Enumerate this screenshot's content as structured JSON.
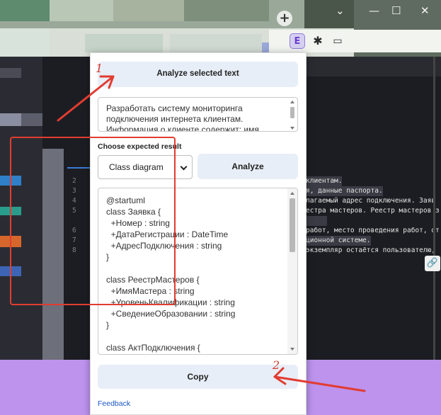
{
  "browser": {
    "new_tab_symbol": "+",
    "window_controls": {
      "minimize": "—",
      "maximize": "☐",
      "close": "✕",
      "collapse": "⌄"
    },
    "toolbar_icons": [
      "extension-active-icon",
      "puzzle-icon",
      "sidebar-icon"
    ],
    "ext_glyph": "E",
    "puzzle_glyph": "✱",
    "side_glyph": "▭"
  },
  "background_code": {
    "line_numbers": [
      "2",
      "3",
      "4",
      "5",
      "6",
      "7",
      "8"
    ],
    "lines": [
      "клиентам.",
      "я, данные паспорта.",
      "лагаемый адрес подключения. Заяв",
      "естра мастеров. Реестр мастеров з",
      "",
      "работ, место проведения работ, от",
      "ционной системе.",
      "экземпляр остаётся пользователю,"
    ],
    "link_glyph": "🔗"
  },
  "popup": {
    "analyze_selected_label": "Analyze selected text",
    "input_text": "Разработать систему мониторинга подключения интернета клиентам. Информация о клиенте содержит: имя",
    "choose_label": "Choose expected result",
    "selected_option": "Class diagram",
    "analyze_label": "Analyze",
    "output_text": "@startuml\nclass Заявка {\n  +Номер : string\n  +ДатаРегистрации : DateTime\n  +АдресПодключения : string\n}\n\nclass РеестрМастеров {\n  +ИмяМастера : string\n  +УровеньКвалификации : string\n  +СведениеОбразовании : string\n}\n\nclass АктПодключения {\n  +Номер : string",
    "copy_label": "Copy",
    "feedback_label": "Feedback"
  },
  "annotations": {
    "step1": "1",
    "step2": "2",
    "color": "#e23c31"
  },
  "colors": {
    "button_bg": "#e8eef8",
    "link": "#1a55c6",
    "purple_bg": "#bd93ee",
    "highlight": "#e23c31"
  }
}
